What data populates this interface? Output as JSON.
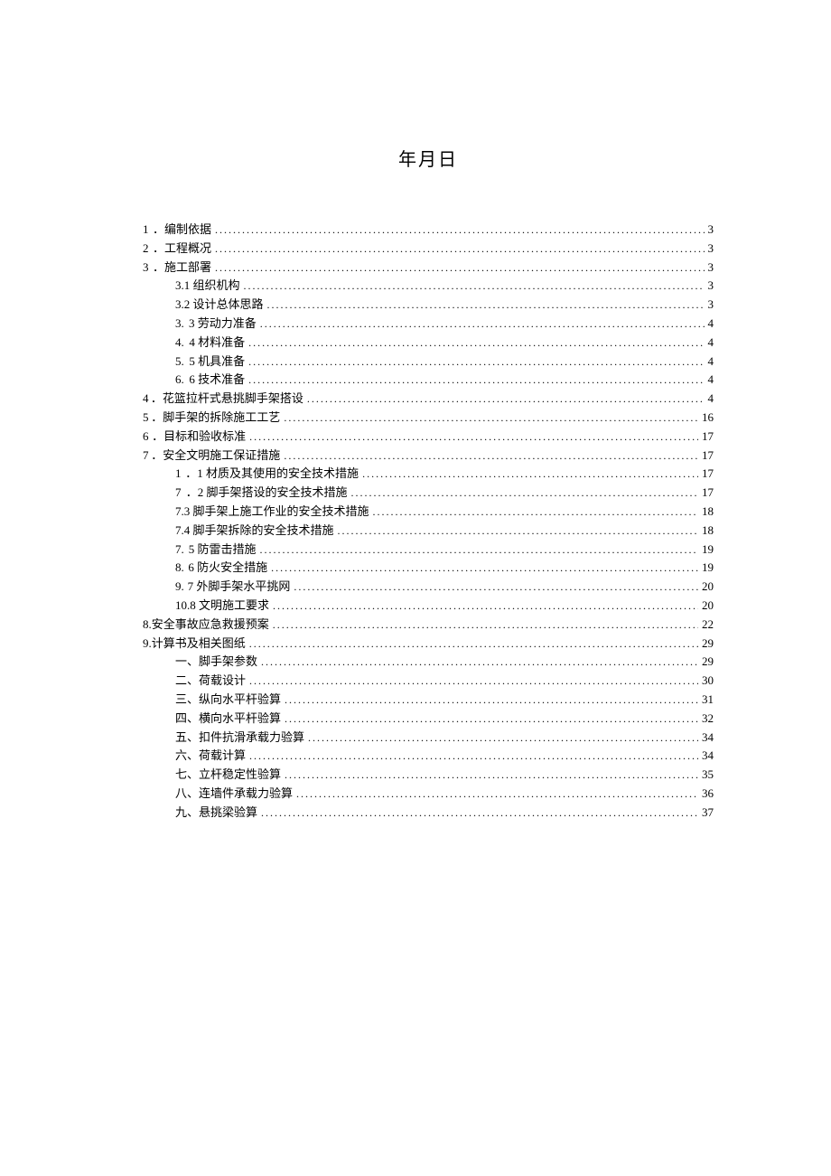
{
  "title": "年月日",
  "toc": [
    {
      "level": "l0",
      "marker": "1",
      "label": "．编制依据",
      "page": "3"
    },
    {
      "level": "l0",
      "marker": "2",
      "label": "．工程概况",
      "page": "3"
    },
    {
      "level": "l0",
      "marker": "3",
      "label": "．施工部署",
      "page": "3"
    },
    {
      "level": "l1",
      "marker": "",
      "label": "3.1 组织机构",
      "page": "3"
    },
    {
      "level": "l1",
      "marker": "",
      "label": "3.2 设计总体思路",
      "page": "3"
    },
    {
      "level": "l2",
      "marker": "3.",
      "label": "3 劳动力准备",
      "page": "4"
    },
    {
      "level": "l2",
      "marker": "4.",
      "label": "4 材料准备",
      "page": "4"
    },
    {
      "level": "l2",
      "marker": "5.",
      "label": "5 机具准备",
      "page": "4"
    },
    {
      "level": "l2",
      "marker": "6.",
      "label": "6 技术准备",
      "page": "4"
    },
    {
      "level": "l0",
      "marker": "4",
      "label": "．花篮拉杆式悬挑脚手架搭设",
      "page": "4"
    },
    {
      "level": "l0",
      "marker": "5",
      "label": "．脚手架的拆除施工工艺",
      "page": "16"
    },
    {
      "level": "l0",
      "marker": "6",
      "label": "．目标和验收标准",
      "page": "17"
    },
    {
      "level": "l0",
      "marker": "7",
      "label": "．安全文明施工保证措施",
      "page": "17"
    },
    {
      "level": "l2",
      "marker": "1",
      "label": "．1 材质及其使用的安全技术措施",
      "page": "17"
    },
    {
      "level": "l2",
      "marker": "7",
      "label": "．2 脚手架搭设的安全技术措施",
      "page": "17"
    },
    {
      "level": "l1",
      "marker": "",
      "label": "7.3 脚手架上施工作业的安全技术措施",
      "page": "18"
    },
    {
      "level": "l1",
      "marker": "",
      "label": "7.4 脚手架拆除的安全技术措施",
      "page": "18"
    },
    {
      "level": "l2",
      "marker": "7.",
      "label": "5 防雷击措施",
      "page": "19"
    },
    {
      "level": "l2",
      "marker": "8.",
      "label": "6 防火安全措施",
      "page": "19"
    },
    {
      "level": "l2",
      "marker": "9.",
      "label": "7 外脚手架水平挑网",
      "page": "20"
    },
    {
      "level": "l2",
      "marker": "10.",
      "label": "8 文明施工要求",
      "page": "20"
    },
    {
      "level": "l1b",
      "marker": "",
      "label": "8.安全事故应急救援预案",
      "page": "22"
    },
    {
      "level": "l1b",
      "marker": "",
      "label": "9.计算书及相关图纸",
      "page": "29"
    },
    {
      "level": "l2b",
      "marker": "",
      "label": "一、脚手架参数",
      "page": "29"
    },
    {
      "level": "l2b",
      "marker": "",
      "label": "二、荷载设计",
      "page": "30"
    },
    {
      "level": "l2b",
      "marker": "",
      "label": "三、纵向水平杆验算",
      "page": "31"
    },
    {
      "level": "l2b",
      "marker": "",
      "label": "四、横向水平杆验算",
      "page": "32"
    },
    {
      "level": "l2b",
      "marker": "",
      "label": "五、扣件抗滑承载力验算",
      "page": "34"
    },
    {
      "level": "l2b",
      "marker": "",
      "label": "六、荷载计算",
      "page": "34"
    },
    {
      "level": "l2b",
      "marker": "",
      "label": "七、立杆稳定性验算",
      "page": "35"
    },
    {
      "level": "l2b",
      "marker": "",
      "label": "八、连墙件承载力验算",
      "page": "36"
    },
    {
      "level": "l2b",
      "marker": "",
      "label": "九、悬挑梁验算",
      "page": "37"
    }
  ]
}
